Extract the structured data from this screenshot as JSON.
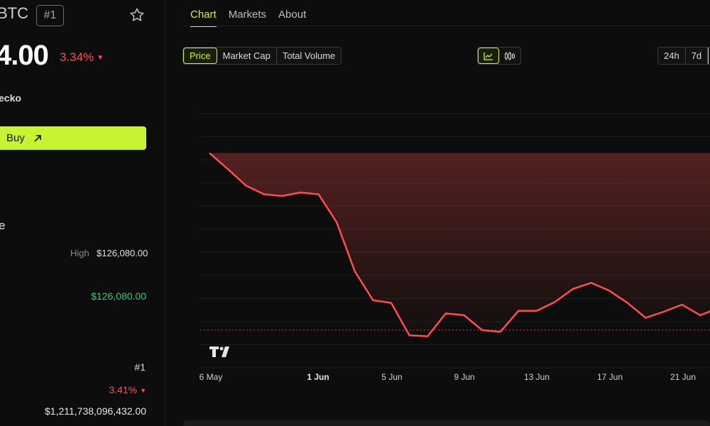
{
  "coin": {
    "ticker": "BTC",
    "rank_badge": "#1",
    "price": "4.00",
    "change_pct": "3.34%",
    "source": "ecko",
    "buy_label": "Buy",
    "section_label": "e",
    "high_label": "High",
    "high_value": "$126,080.00",
    "green_value": "$126,080.00",
    "rank_value": "#1",
    "pct_value": "3.41%",
    "market_cap_value": "$1,211,738,096,432.00"
  },
  "tabs": [
    {
      "label": "Chart",
      "active": true
    },
    {
      "label": "Markets",
      "active": false
    },
    {
      "label": "About",
      "active": false
    }
  ],
  "metric_options": [
    {
      "label": "Price",
      "active": true
    },
    {
      "label": "Market Cap",
      "active": false
    },
    {
      "label": "Total Volume",
      "active": false
    }
  ],
  "chart_type_options": [
    {
      "icon": "line-chart-icon",
      "active": true
    },
    {
      "icon": "candlestick-icon",
      "active": false
    }
  ],
  "range_options": [
    {
      "label": "24h",
      "active": false
    },
    {
      "label": "7d",
      "active": false
    }
  ],
  "colors": {
    "accent": "#c6f432",
    "down": "#ff4d4f",
    "up": "#2fd16a",
    "background": "#0d0d0d"
  },
  "chart_data": {
    "type": "area",
    "x_ticks": [
      "6 May",
      "1 Jun",
      "5 Jun",
      "9 Jun",
      "13 Jun",
      "17 Jun",
      "21 Jun"
    ],
    "values": [
      112.5,
      110.7,
      108.8,
      107.8,
      107.6,
      108.0,
      107.8,
      104.6,
      99.0,
      95.7,
      95.4,
      91.7,
      91.6,
      94.2,
      94.0,
      92.3,
      92.1,
      94.5,
      94.5,
      95.5,
      97.0,
      97.7,
      96.8,
      95.4,
      93.7,
      94.4,
      95.2,
      94.0,
      94.8
    ],
    "baseline": 92.3,
    "ylim": [
      88,
      117
    ],
    "grid": true,
    "line_color": "#ff4d4f"
  }
}
